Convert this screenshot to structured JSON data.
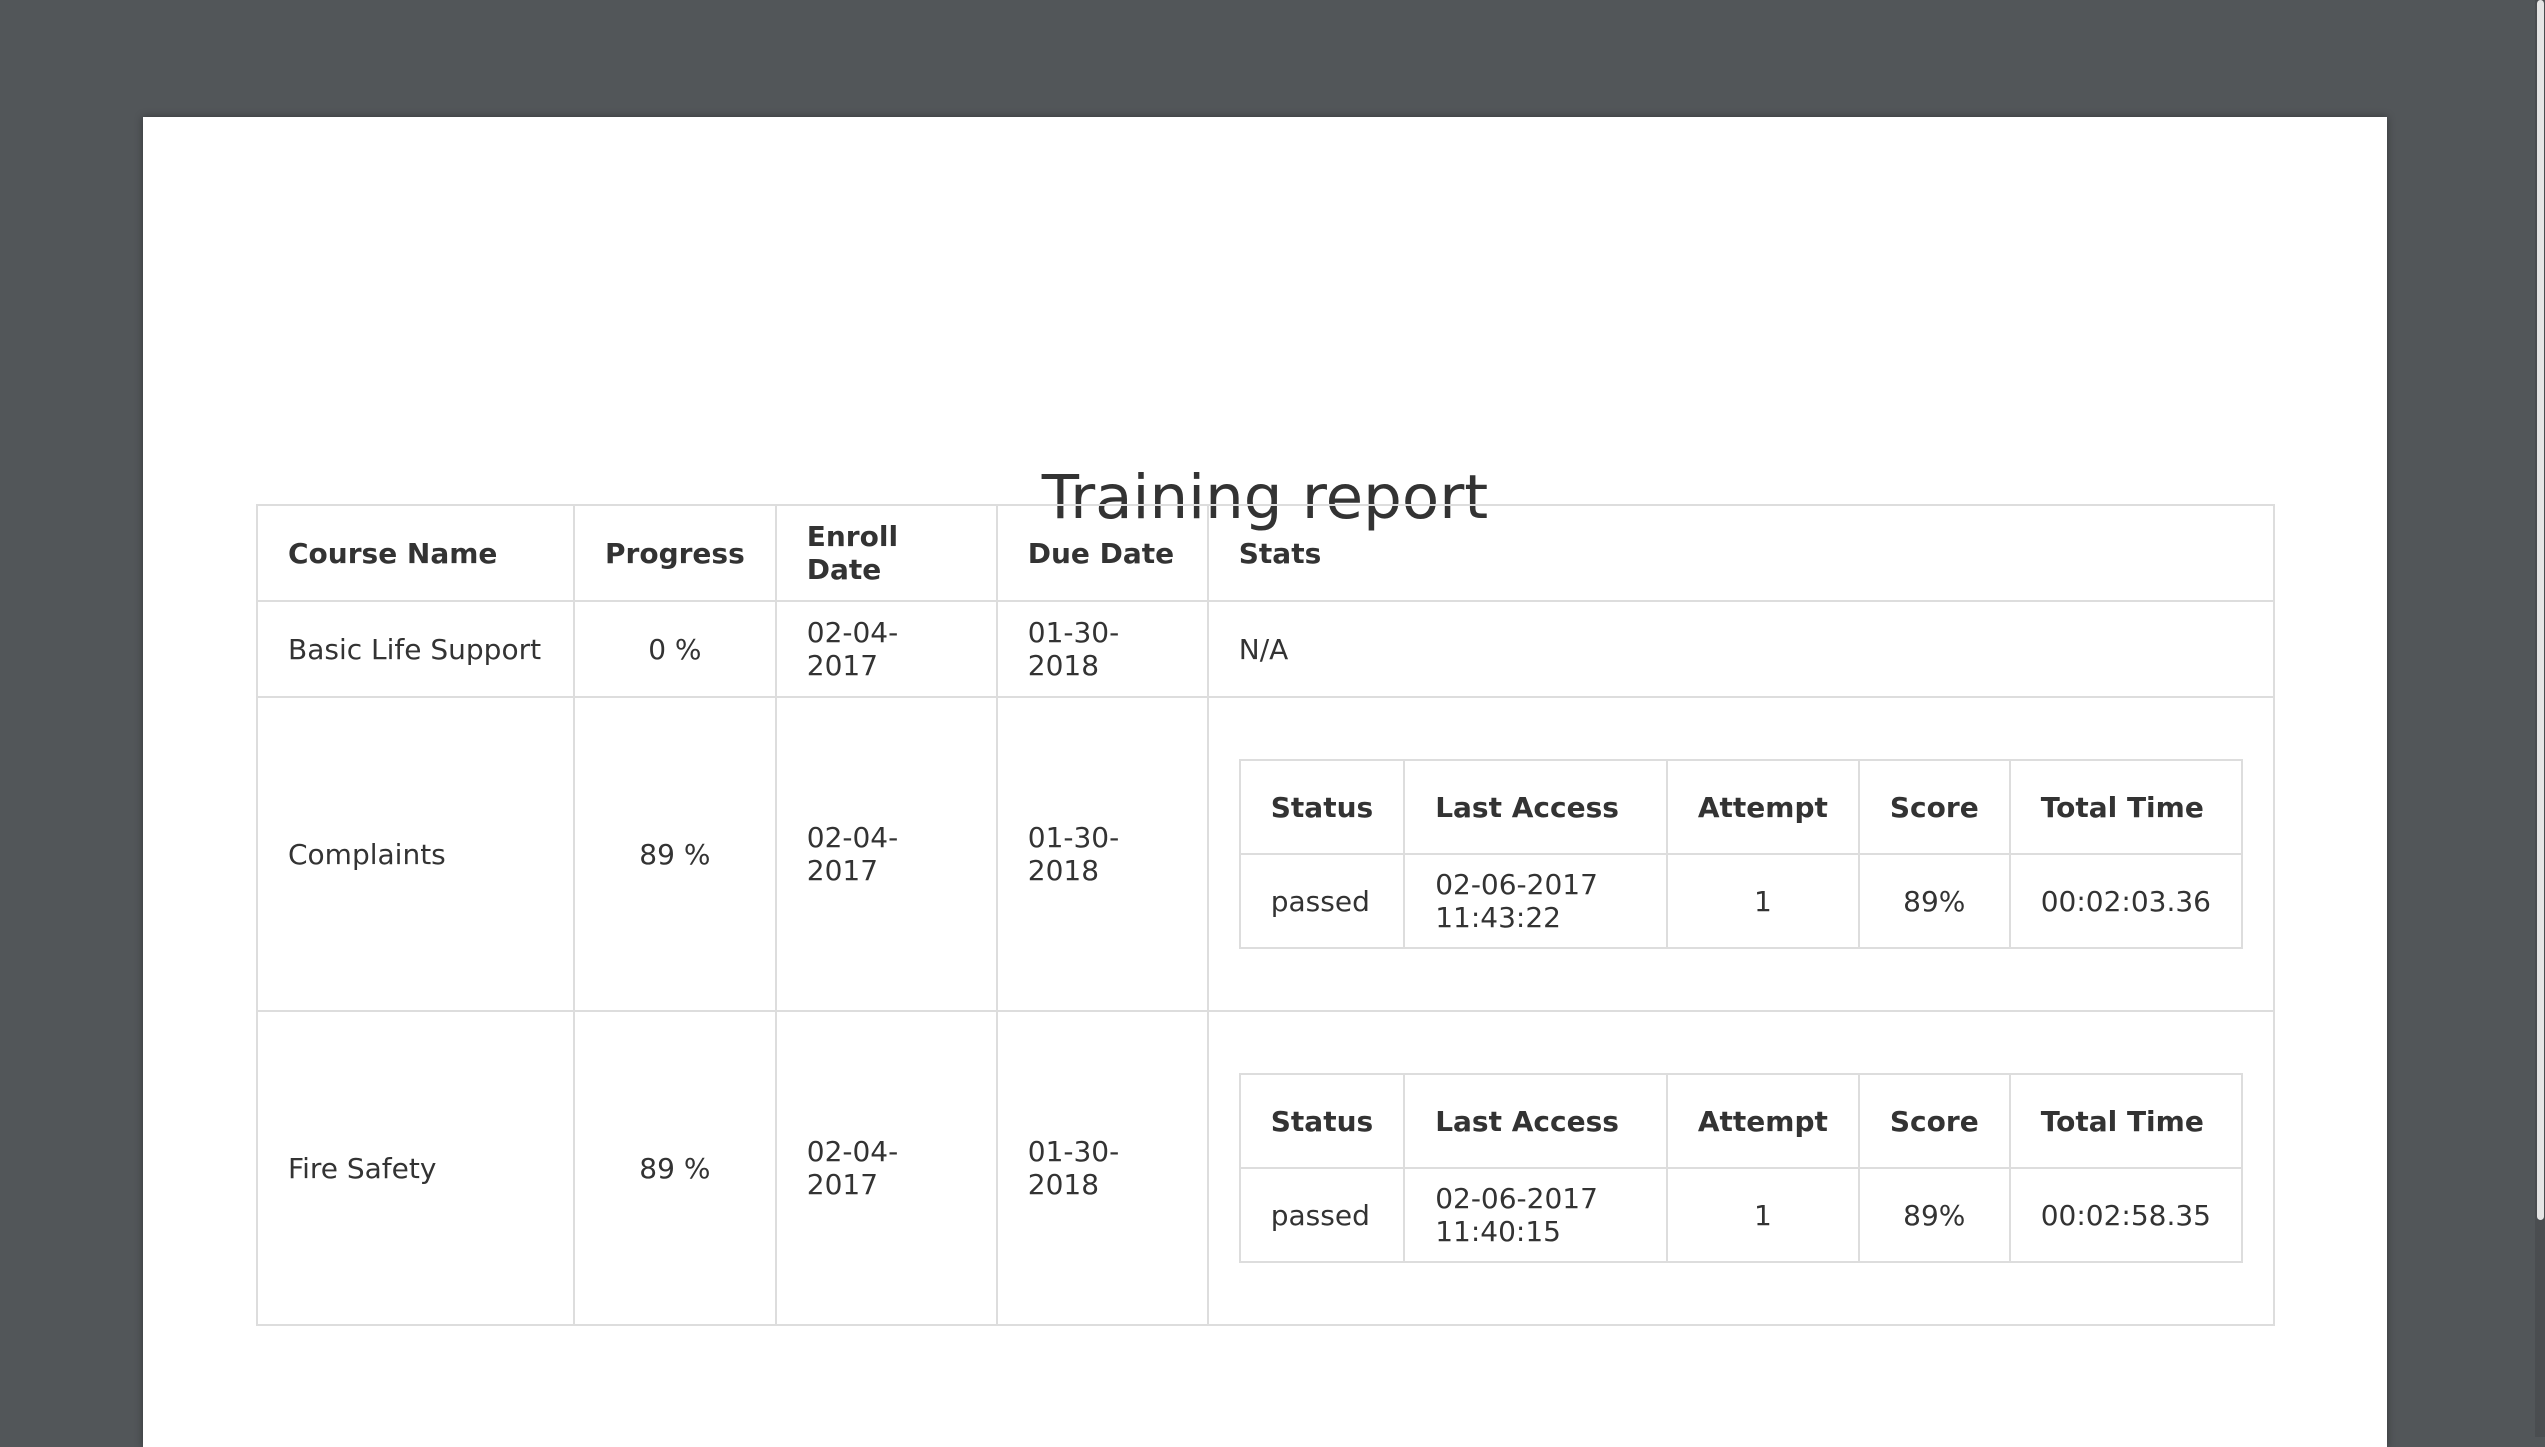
{
  "report": {
    "title": "Training report"
  },
  "table": {
    "columns": [
      "Course Name",
      "Progress",
      "Enroll Date",
      "Due Date",
      "Stats"
    ],
    "rows": [
      {
        "course_name": "Basic Life Support",
        "progress": "0 %",
        "enroll_date": "02-04-2017",
        "due_date": "01-30-2018",
        "stats_text": "N/A"
      },
      {
        "course_name": "Complaints",
        "progress": "89 %",
        "enroll_date": "02-04-2017",
        "due_date": "01-30-2018",
        "stats": {
          "columns": [
            "Status",
            "Last Access",
            "Attempt",
            "Score",
            "Total Time"
          ],
          "status": "passed",
          "last_access": "02-06-2017 11:43:22",
          "attempt": "1",
          "score": "89%",
          "total_time": "00:02:03.36"
        }
      },
      {
        "course_name": "Fire Safety",
        "progress": "89 %",
        "enroll_date": "02-04-2017",
        "due_date": "01-30-2018",
        "stats": {
          "columns": [
            "Status",
            "Last Access",
            "Attempt",
            "Score",
            "Total Time"
          ],
          "status": "passed",
          "last_access": "02-06-2017 11:40:15",
          "attempt": "1",
          "score": "89%",
          "total_time": "00:02:58.35"
        }
      }
    ]
  },
  "colors": {
    "viewer_background": "#525659",
    "page_background": "#ffffff",
    "text": "#333333",
    "table_border": "#dddddd"
  }
}
